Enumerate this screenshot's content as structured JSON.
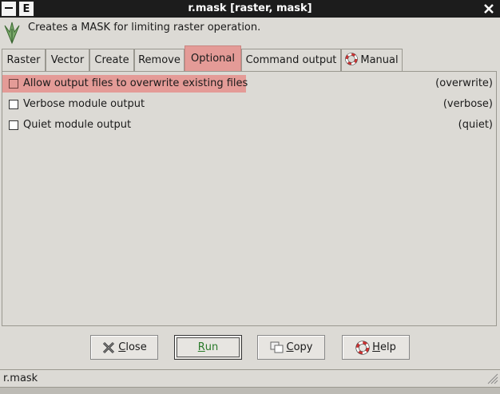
{
  "window": {
    "title": "r.mask [raster, mask]",
    "menu_button": "",
    "e_button": "E"
  },
  "description": {
    "text": "Creates a MASK for limiting raster operation."
  },
  "tabs": [
    {
      "label": "Raster",
      "active": false
    },
    {
      "label": "Vector",
      "active": false
    },
    {
      "label": "Create",
      "active": false
    },
    {
      "label": "Remove",
      "active": false
    },
    {
      "label": "Optional",
      "active": true
    },
    {
      "label": "Command output",
      "active": false
    },
    {
      "label": "Manual",
      "active": false
    }
  ],
  "options": [
    {
      "label": "Allow output files to overwrite existing files",
      "flag": "(overwrite)",
      "checked": false
    },
    {
      "label": "Verbose module output",
      "flag": "(verbose)",
      "checked": false
    },
    {
      "label": "Quiet module output",
      "flag": "(quiet)",
      "checked": false
    }
  ],
  "buttons": {
    "close": "Close",
    "run": "Run",
    "copy": "Copy",
    "help": "Help"
  },
  "status": {
    "text": "r.mask"
  },
  "colors": {
    "highlight": "#e49b97",
    "titlebar": "#1c1c1c",
    "background": "#dcdad5",
    "run_text": "#2a7a2a"
  }
}
